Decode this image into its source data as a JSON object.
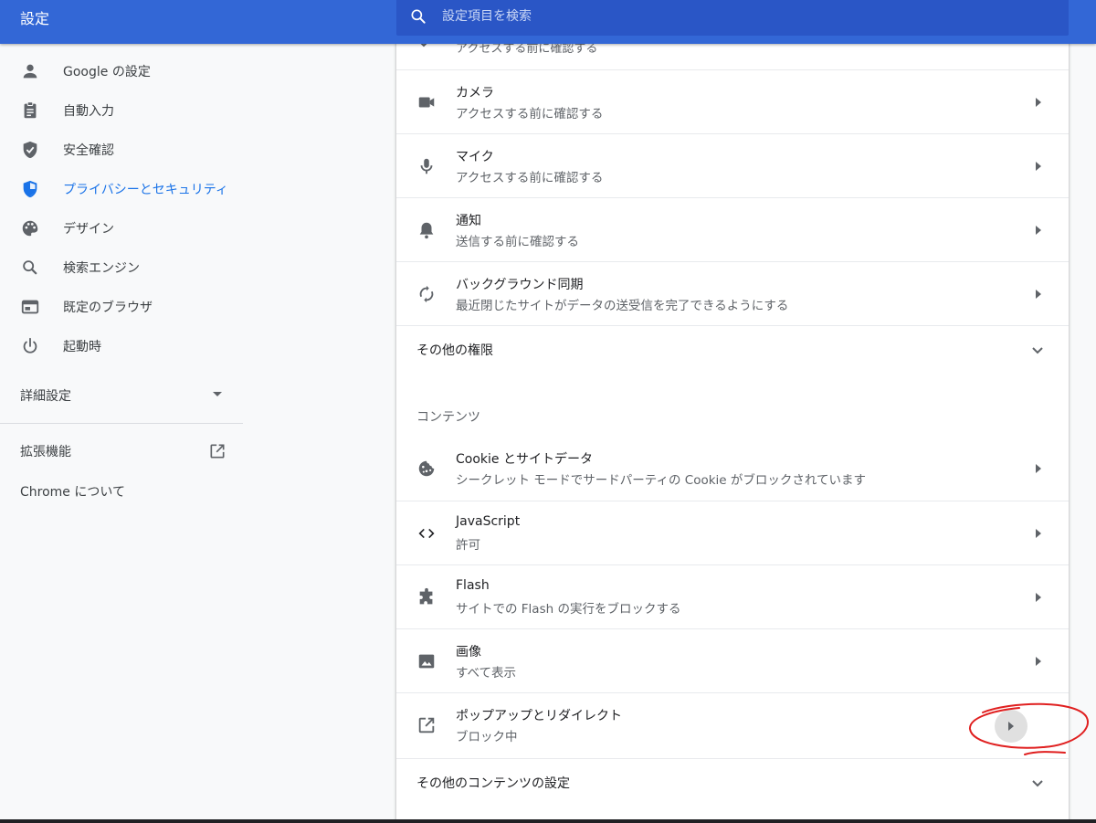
{
  "header": {
    "title": "設定",
    "search_placeholder": "設定項目を検索"
  },
  "sidebar": {
    "items": [
      {
        "label": "Google の設定",
        "icon": "person-icon",
        "active": false
      },
      {
        "label": "自動入力",
        "icon": "clipboard-icon",
        "active": false
      },
      {
        "label": "安全確認",
        "icon": "shield-check-icon",
        "active": false
      },
      {
        "label": "プライバシーとセキュリティ",
        "icon": "security-shield-icon",
        "active": true
      },
      {
        "label": "デザイン",
        "icon": "palette-icon",
        "active": false
      },
      {
        "label": "検索エンジン",
        "icon": "search-icon",
        "active": false
      },
      {
        "label": "既定のブラウザ",
        "icon": "browser-window-icon",
        "active": false
      },
      {
        "label": "起動時",
        "icon": "power-icon",
        "active": false
      }
    ],
    "advanced_label": "詳細設定",
    "extensions_label": "拡張機能",
    "about_label": "Chrome について"
  },
  "main": {
    "partial_row_subtitle": "アクセスする前に確認する",
    "permission_rows": [
      {
        "title": "カメラ",
        "subtitle": "アクセスする前に確認する",
        "icon": "camera-icon"
      },
      {
        "title": "マイク",
        "subtitle": "アクセスする前に確認する",
        "icon": "microphone-icon"
      },
      {
        "title": "通知",
        "subtitle": "送信する前に確認する",
        "icon": "bell-icon"
      },
      {
        "title": "バックグラウンド同期",
        "subtitle": "最近閉じたサイトがデータの送受信を完了できるようにする",
        "icon": "sync-icon"
      }
    ],
    "more_permissions_label": "その他の権限",
    "content_section_title": "コンテンツ",
    "content_rows": [
      {
        "title": "Cookie とサイトデータ",
        "subtitle": "シークレット モードでサードパーティの Cookie がブロックされています",
        "icon": "cookie-icon"
      },
      {
        "title": "JavaScript",
        "subtitle": "許可",
        "icon": "code-brackets-icon"
      },
      {
        "title": "Flash",
        "subtitle": "サイトでの Flash の実行をブロックする",
        "icon": "puzzle-piece-icon"
      },
      {
        "title": "画像",
        "subtitle": "すべて表示",
        "icon": "image-icon"
      },
      {
        "title": "ポップアップとリダイレクト",
        "subtitle": "ブロック中",
        "icon": "open-in-new-icon"
      }
    ],
    "more_content_label": "その他のコンテンツの設定"
  },
  "colors": {
    "accent": "#1a73e8",
    "topbar": "#3367d6",
    "annotation": "#e02020"
  }
}
